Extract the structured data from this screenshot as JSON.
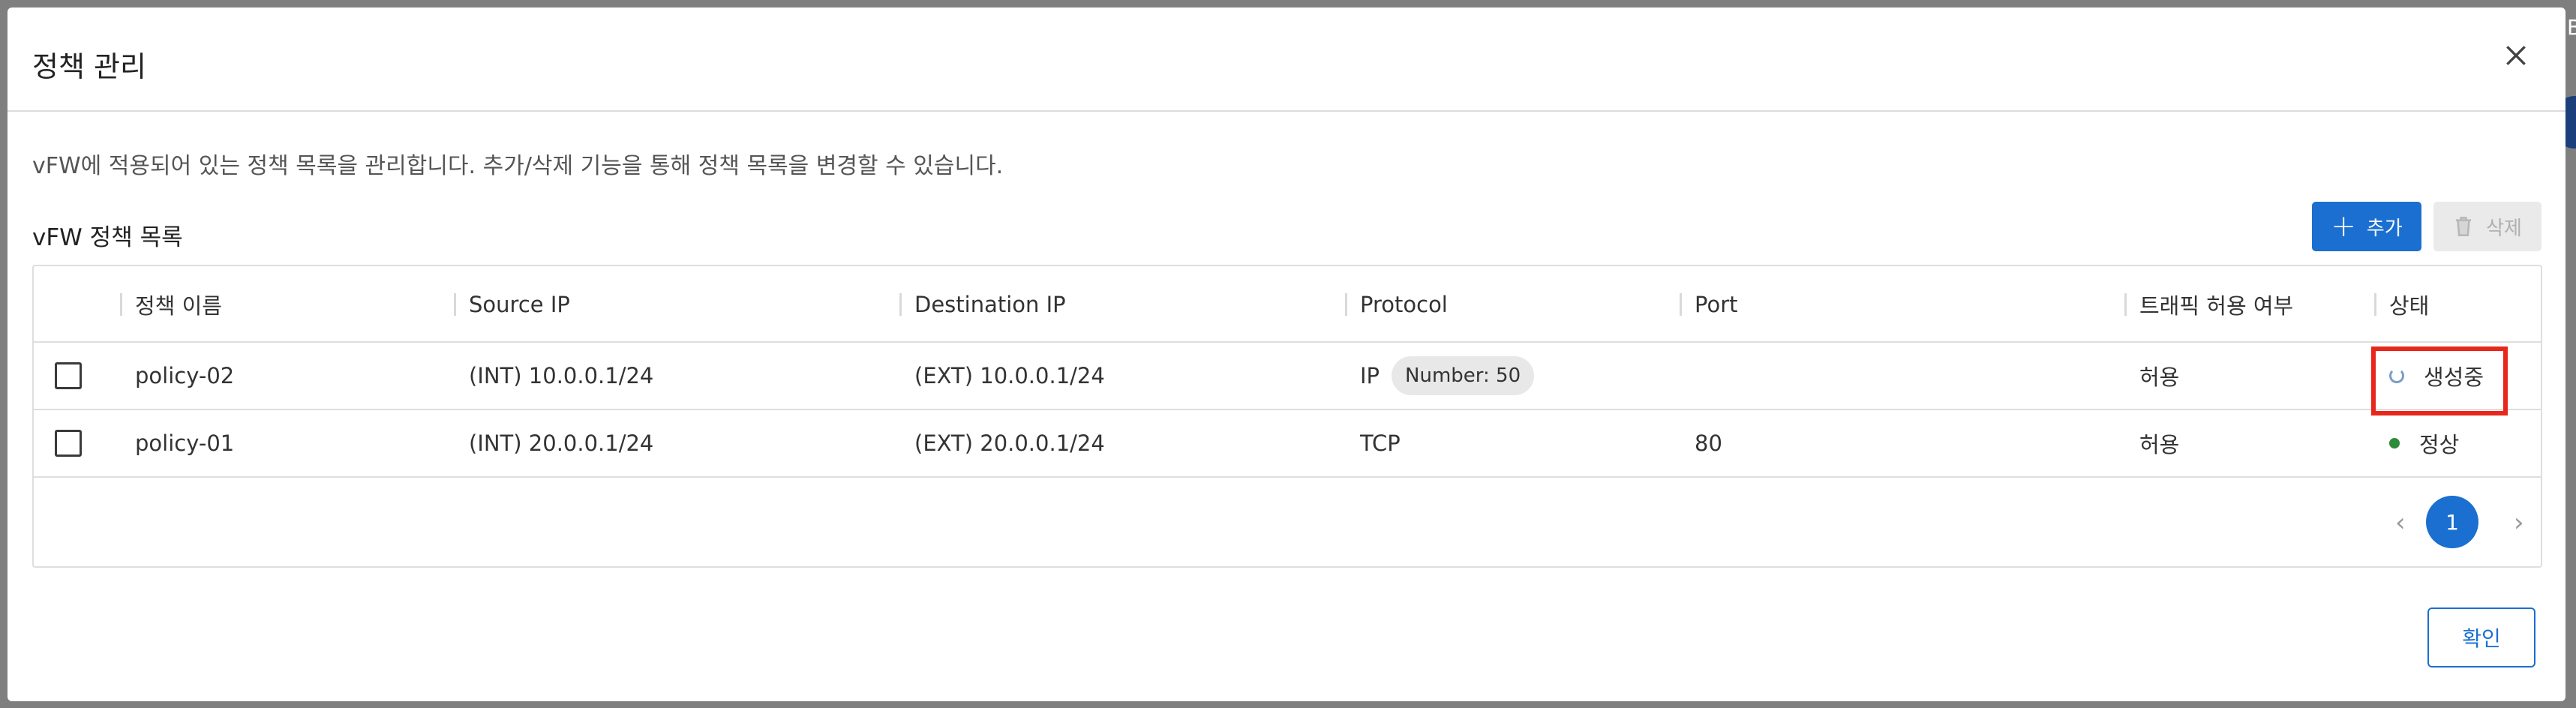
{
  "modal": {
    "title": "정책 관리",
    "description": "vFW에 적용되어 있는 정책 목록을 관리합니다. 추가/삭제 기능을 통해 정책 목록을 변경할 수 있습니다.",
    "list_title": "vFW 정책 목록",
    "add_label": "추가",
    "delete_label": "삭제",
    "ok_label": "확인"
  },
  "backdrop": {
    "edge_text": "B"
  },
  "table": {
    "headers": {
      "name": "정책 이름",
      "source_ip": "Source IP",
      "destination_ip": "Destination IP",
      "protocol": "Protocol",
      "port": "Port",
      "traffic": "트래픽 허용 여부",
      "status": "상태"
    },
    "rows": [
      {
        "name": "policy-02",
        "source_ip": "(INT) 10.0.0.1/24",
        "destination_ip": "(EXT) 10.0.0.1/24",
        "protocol": "IP",
        "protocol_chip": "Number: 50",
        "port": "",
        "traffic": "허용",
        "status": "생성중"
      },
      {
        "name": "policy-01",
        "source_ip": "(INT) 20.0.0.1/24",
        "destination_ip": "(EXT) 20.0.0.1/24",
        "protocol": "TCP",
        "port": "80",
        "traffic": "허용",
        "status": "정상"
      }
    ]
  },
  "pagination": {
    "current": "1",
    "prev": "‹",
    "next": "›"
  },
  "colors": {
    "primary": "#1a6fd1",
    "highlight": "#e8271c",
    "status_ok": "#2e8b3a"
  }
}
